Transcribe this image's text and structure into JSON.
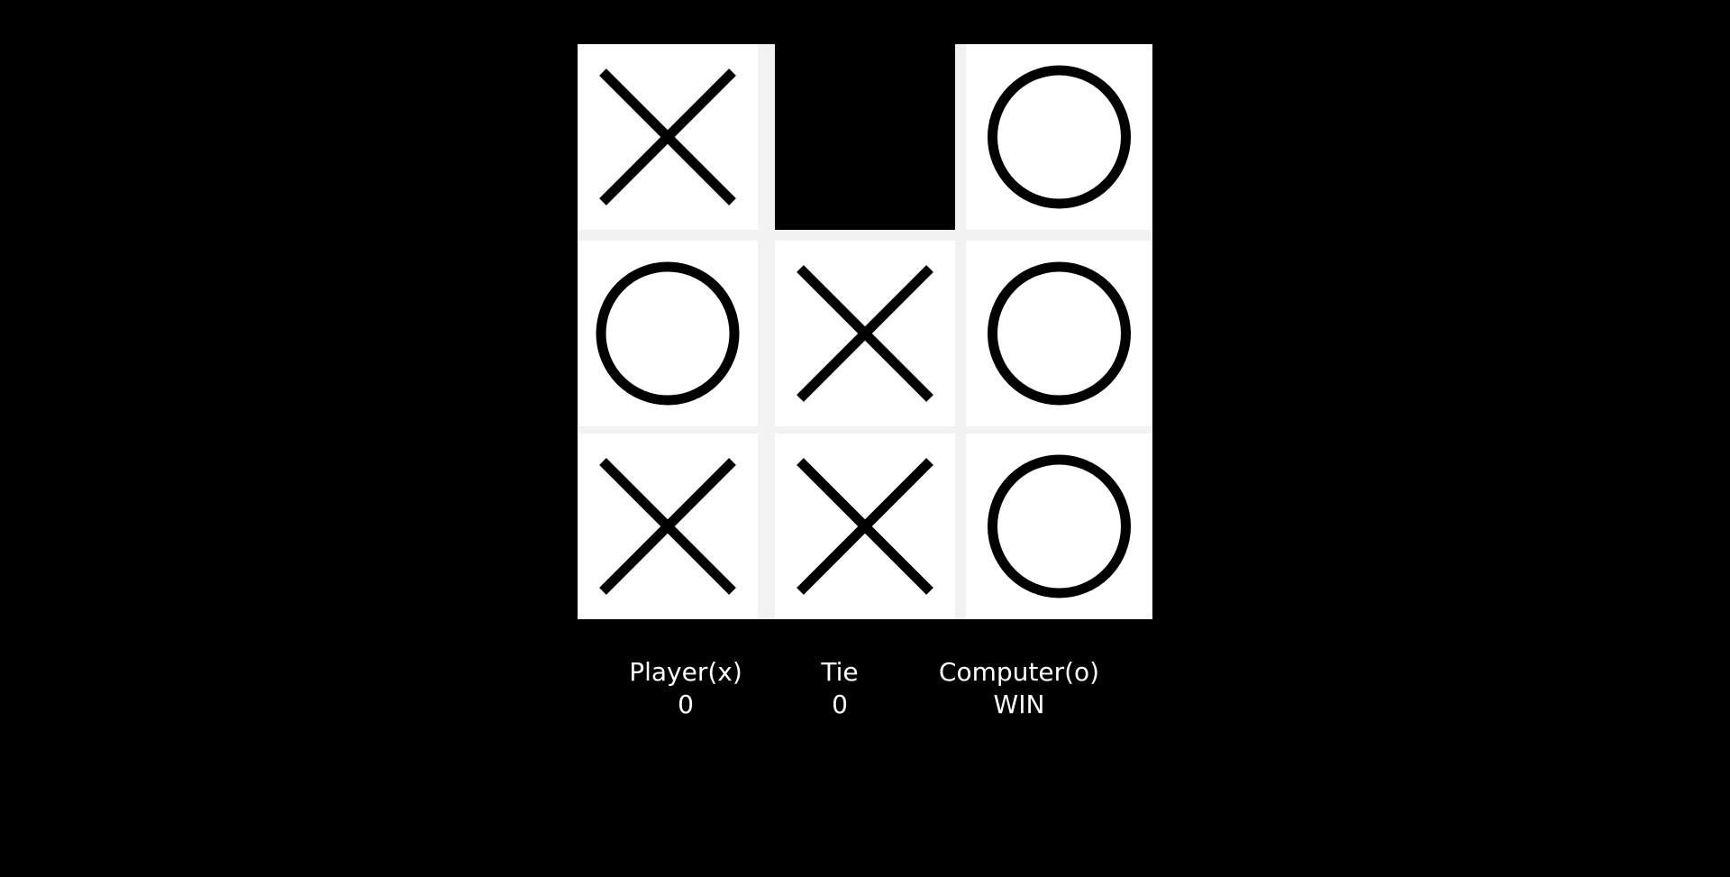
{
  "board": {
    "cells": [
      "x",
      "",
      "o",
      "o",
      "x",
      "o",
      "x",
      "x",
      "o"
    ]
  },
  "scores": {
    "player": {
      "label": "Player(x)",
      "value": "0"
    },
    "tie": {
      "label": "Tie",
      "value": "0"
    },
    "computer": {
      "label": "Computer(o)",
      "value": "WIN"
    }
  }
}
